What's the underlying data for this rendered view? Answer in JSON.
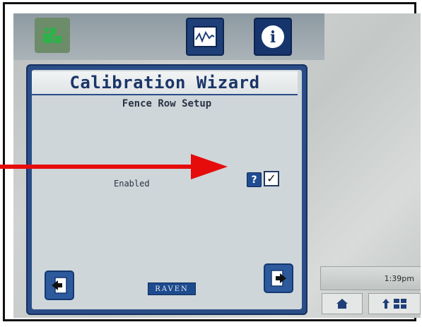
{
  "topbar": {
    "buttons": [
      {
        "icon": "machine-config-icon"
      },
      {
        "icon": "graph-icon"
      },
      {
        "icon": "info-icon",
        "glyph": "i"
      }
    ]
  },
  "dialog": {
    "title": "Calibration Wizard",
    "subtitle": "Fence Row Setup",
    "row_label": "Enabled",
    "help_glyph": "?",
    "checkbox_checked": true,
    "checkbox_glyph": "✓",
    "logo": "RAVEN",
    "back_icon": "back-page-icon",
    "next_icon": "next-page-icon"
  },
  "status": {
    "time": "1:39pm"
  },
  "colors": {
    "dialog_blue": "#2b4d87",
    "title_text": "#1b3568",
    "annotation_red": "#e60c0c"
  }
}
